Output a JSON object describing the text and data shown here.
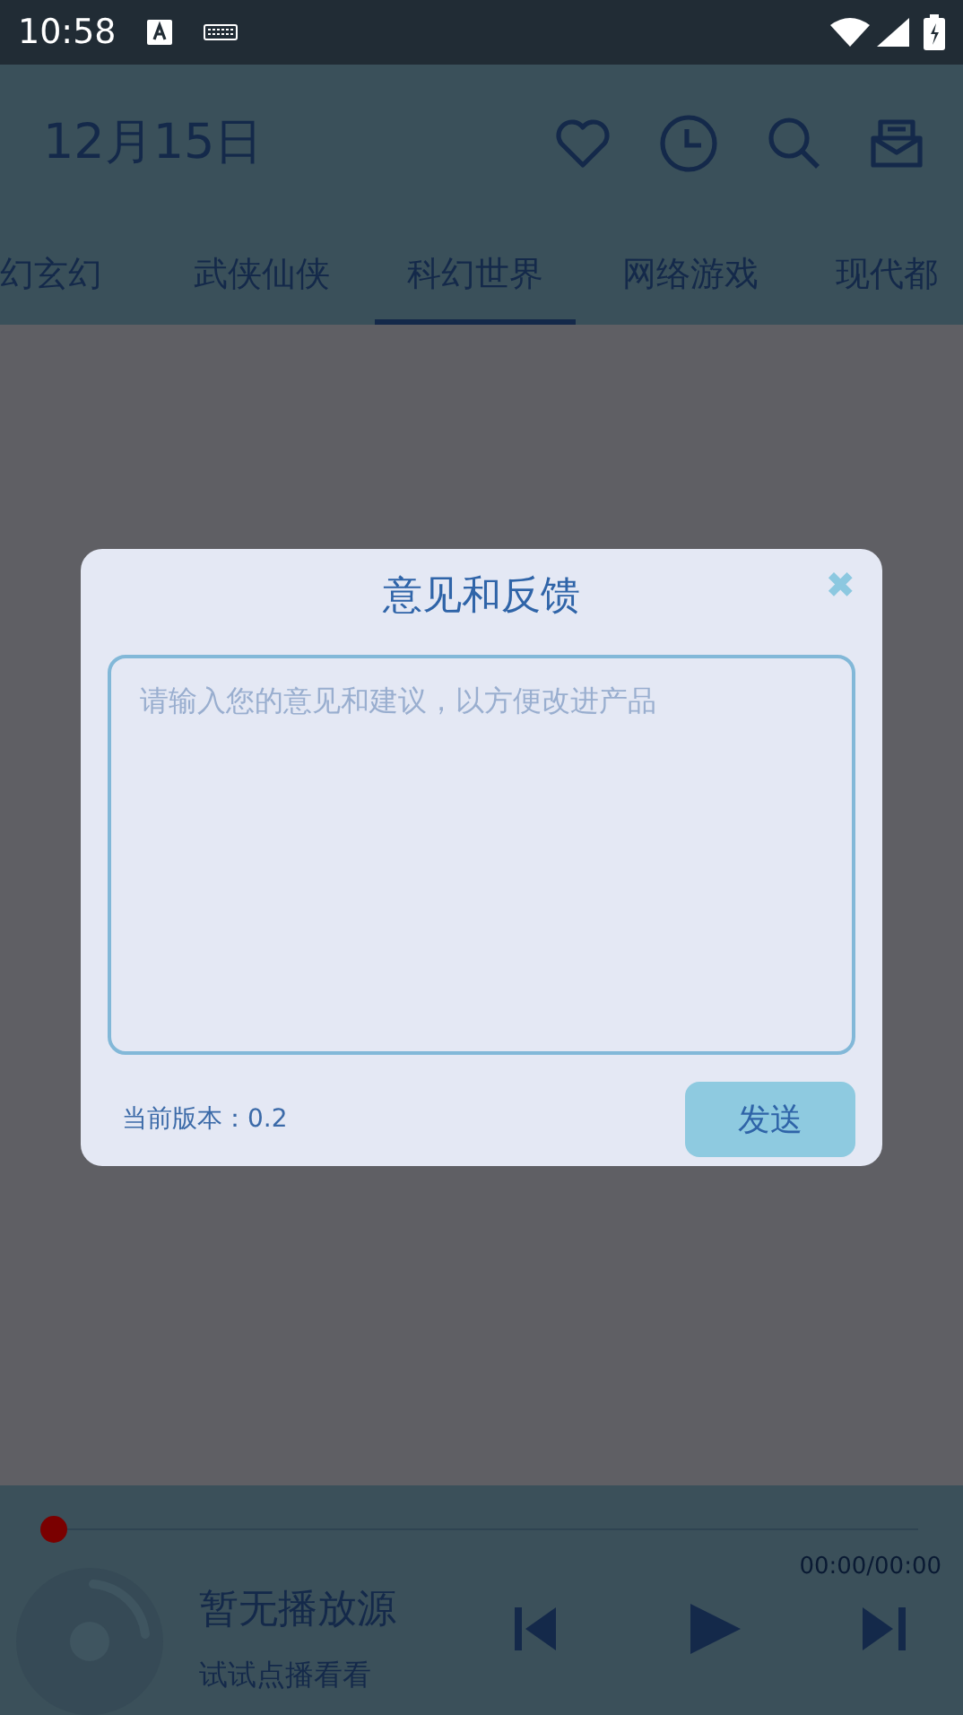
{
  "status_bar": {
    "time": "10:58"
  },
  "app_bar": {
    "title": "12月15日"
  },
  "tabs": [
    {
      "label": "幻玄幻",
      "selected": false
    },
    {
      "label": "武侠仙侠",
      "selected": false
    },
    {
      "label": "科幻世界",
      "selected": true
    },
    {
      "label": "网络游戏",
      "selected": false
    },
    {
      "label": "现代都",
      "selected": false
    }
  ],
  "dialog": {
    "title": "意见和反馈",
    "close": "✖",
    "placeholder": "请输入您的意见和建议，以方便改进产品",
    "version": "当前版本：0.2",
    "send": "发送"
  },
  "player": {
    "level": 0,
    "time": "00:00/00:00",
    "title": "暂无播放源",
    "subtitle": "试试点播看看"
  }
}
